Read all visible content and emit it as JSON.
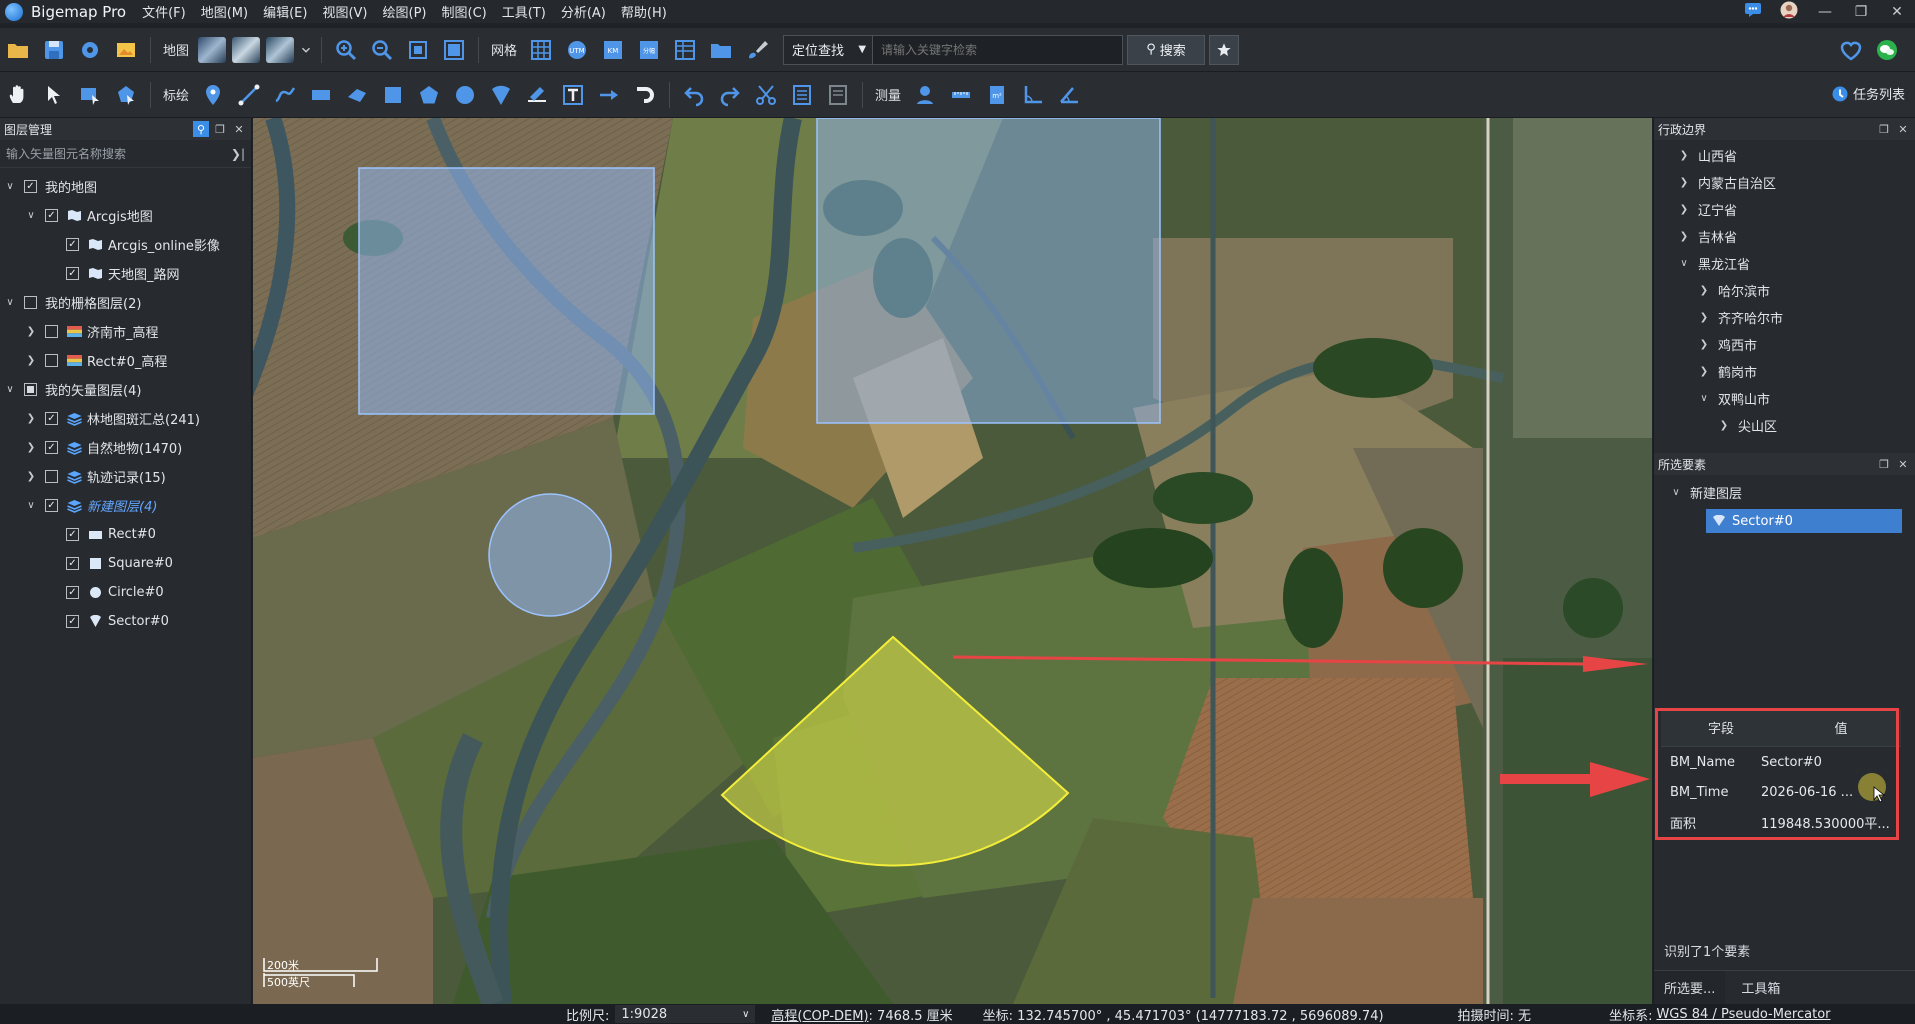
{
  "app": {
    "title": "Bigemap Pro"
  },
  "menu": [
    "文件(F)",
    "地图(M)",
    "编辑(E)",
    "视图(V)",
    "绘图(P)",
    "制图(C)",
    "工具(T)",
    "分析(A)",
    "帮助(H)"
  ],
  "toolbar1": {
    "map_label": "地图",
    "grid_label": "网格",
    "locate_select": "定位查找",
    "search_placeholder": "请输入关键字检索",
    "search_button": "搜索"
  },
  "toolbar2": {
    "annotate_label": "标绘",
    "measure_label": "测量",
    "task_list": "任务列表"
  },
  "layers": {
    "title": "图层管理",
    "search_placeholder": "输入矢量图元名称搜索",
    "rows": [
      {
        "label": "我的地图",
        "indent": 0,
        "caret": "v",
        "checked": true,
        "icon": "none",
        "style": ""
      },
      {
        "label": "Arcgis地图",
        "indent": 1,
        "caret": "v",
        "checked": true,
        "icon": "map",
        "style": ""
      },
      {
        "label": "Arcgis_online影像",
        "indent": 2,
        "caret": "",
        "checked": true,
        "icon": "map",
        "style": ""
      },
      {
        "label": "天地图_路网",
        "indent": 2,
        "caret": "",
        "checked": true,
        "icon": "map",
        "style": ""
      },
      {
        "label": "我的栅格图层(2)",
        "indent": 0,
        "caret": "v",
        "checked": false,
        "icon": "none",
        "style": ""
      },
      {
        "label": "济南市_高程",
        "indent": 1,
        "caret": ">",
        "checked": false,
        "icon": "raster",
        "style": ""
      },
      {
        "label": "Rect#0_高程",
        "indent": 1,
        "caret": ">",
        "checked": false,
        "icon": "raster",
        "style": ""
      },
      {
        "label": "我的矢量图层(4)",
        "indent": 0,
        "caret": "v",
        "checked": "partial",
        "icon": "none",
        "style": ""
      },
      {
        "label": "林地图斑汇总(241)",
        "indent": 1,
        "caret": ">",
        "checked": true,
        "icon": "stack",
        "style": ""
      },
      {
        "label": "自然地物(1470)",
        "indent": 1,
        "caret": ">",
        "checked": true,
        "icon": "stack",
        "style": ""
      },
      {
        "label": "轨迹记录(15)",
        "indent": 1,
        "caret": ">",
        "checked": false,
        "icon": "stack",
        "style": ""
      },
      {
        "label": "新建图层(4)",
        "indent": 1,
        "caret": "v",
        "checked": true,
        "icon": "stack",
        "style": "italic-blue"
      },
      {
        "label": "Rect#0",
        "indent": 2,
        "caret": "",
        "checked": true,
        "icon": "rect",
        "style": ""
      },
      {
        "label": "Square#0",
        "indent": 2,
        "caret": "",
        "checked": true,
        "icon": "square",
        "style": ""
      },
      {
        "label": "Circle#0",
        "indent": 2,
        "caret": "",
        "checked": true,
        "icon": "circle",
        "style": ""
      },
      {
        "label": "Sector#0",
        "indent": 2,
        "caret": "",
        "checked": true,
        "icon": "sector",
        "style": ""
      }
    ]
  },
  "map": {
    "scale_metric": "200米",
    "scale_imperial": "500英尺"
  },
  "admin": {
    "title": "行政边界",
    "rows": [
      {
        "label": "山西省",
        "indent": 1,
        "caret": ">"
      },
      {
        "label": "内蒙古自治区",
        "indent": 1,
        "caret": ">"
      },
      {
        "label": "辽宁省",
        "indent": 1,
        "caret": ">"
      },
      {
        "label": "吉林省",
        "indent": 1,
        "caret": ">"
      },
      {
        "label": "黑龙江省",
        "indent": 1,
        "caret": "v"
      },
      {
        "label": "哈尔滨市",
        "indent": 2,
        "caret": ">"
      },
      {
        "label": "齐齐哈尔市",
        "indent": 2,
        "caret": ">"
      },
      {
        "label": "鸡西市",
        "indent": 2,
        "caret": ">"
      },
      {
        "label": "鹤岗市",
        "indent": 2,
        "caret": ">"
      },
      {
        "label": "双鸭山市",
        "indent": 2,
        "caret": "v"
      },
      {
        "label": "尖山区",
        "indent": 3,
        "caret": ">"
      }
    ]
  },
  "selected": {
    "title": "所选要素",
    "group": "新建图层",
    "item": "Sector#0",
    "field_header": "字段",
    "value_header": "值",
    "props": [
      {
        "k": "BM_Name",
        "v": "Sector#0"
      },
      {
        "k": "BM_Time",
        "v": "2026-06-16 ..."
      },
      {
        "k": "面积",
        "v": "119848.530000平..."
      }
    ],
    "count_text": "识别了1个要素",
    "tab_selected": "所选要...",
    "tab_toolbox": "工具箱"
  },
  "status": {
    "scale_label": "比例尺:",
    "scale_value": "1:9028",
    "elevation_label": "高程(COP-DEM)",
    "elevation_value": ": 7468.5 厘米",
    "coord_text": "坐标: 132.745700° , 45.471703°  (14777183.72 , 5696089.74)",
    "shot_time": "拍摄时间: 无",
    "crs_label": "坐标系:",
    "crs_value": "WGS 84 / Pseudo-Mercator"
  },
  "colors": {
    "accent": "#3f7fcf",
    "highlight_red": "#e74545",
    "sector_fill": "#d8e04a",
    "shape_fill": "#8fb6f0"
  }
}
